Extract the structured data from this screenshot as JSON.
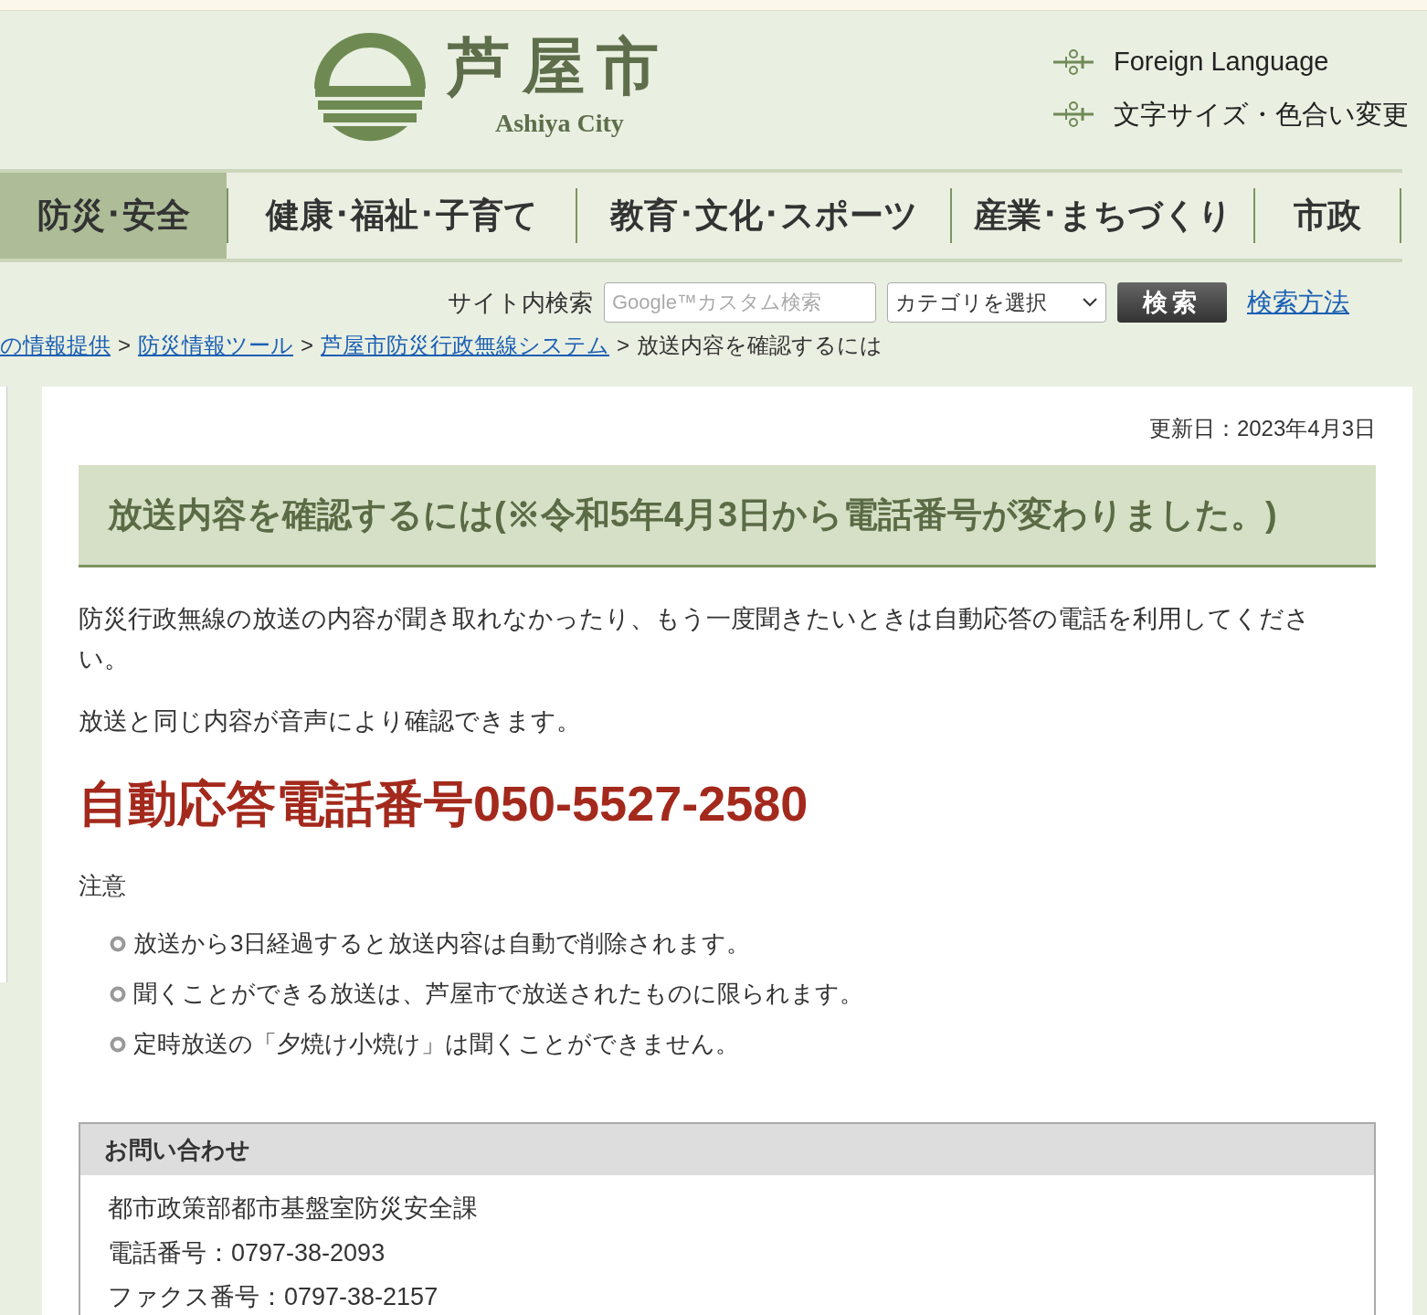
{
  "header": {
    "logo_title": "芦屋市",
    "logo_subtitle": "Ashiya City",
    "links": [
      {
        "label": "Foreign Language"
      },
      {
        "label": "文字サイズ・色合い変更"
      }
    ]
  },
  "nav": {
    "tabs": [
      {
        "label": "防災･安全",
        "selected": true
      },
      {
        "label": "健康･福祉･子育て",
        "selected": false
      },
      {
        "label": "教育･文化･スポーツ",
        "selected": false
      },
      {
        "label": "産業･まちづくり",
        "selected": false
      },
      {
        "label": "市政",
        "selected": false
      }
    ]
  },
  "search": {
    "label": "サイト内検索",
    "placeholder": "Google™カスタム検索",
    "category": "カテゴリを選択",
    "button": "検索",
    "help_link": "検索方法"
  },
  "breadcrumb": {
    "links": [
      "の情報提供",
      "防災情報ツール",
      "芦屋市防災行政無線システム"
    ],
    "current": "放送内容を確認するには",
    "separator": ">"
  },
  "article": {
    "updated": "更新日：2023年4月3日",
    "title": "放送内容を確認するには(※令和5年4月3日から電話番号が変わりました。)",
    "paragraphs": [
      "防災行政無線の放送の内容が聞き取れなかったり、もう一度聞きたいときは自動応答の電話を利用してください。",
      "放送と同じ内容が音声により確認できます。"
    ],
    "phone_heading": "自動応答電話番号050-5527-2580",
    "note_label": "注意",
    "notes": [
      "放送から3日経過すると放送内容は自動で削除されます。",
      "聞くことができる放送は、芦屋市で放送されたものに限られます。",
      "定時放送の「夕焼け小焼け」は聞くことができません。"
    ]
  },
  "contact": {
    "title": "お問い合わせ",
    "lines": [
      "都市政策部都市基盤室防災安全課",
      "電話番号：0797-38-2093",
      "ファクス番号：0797-38-2157"
    ]
  }
}
